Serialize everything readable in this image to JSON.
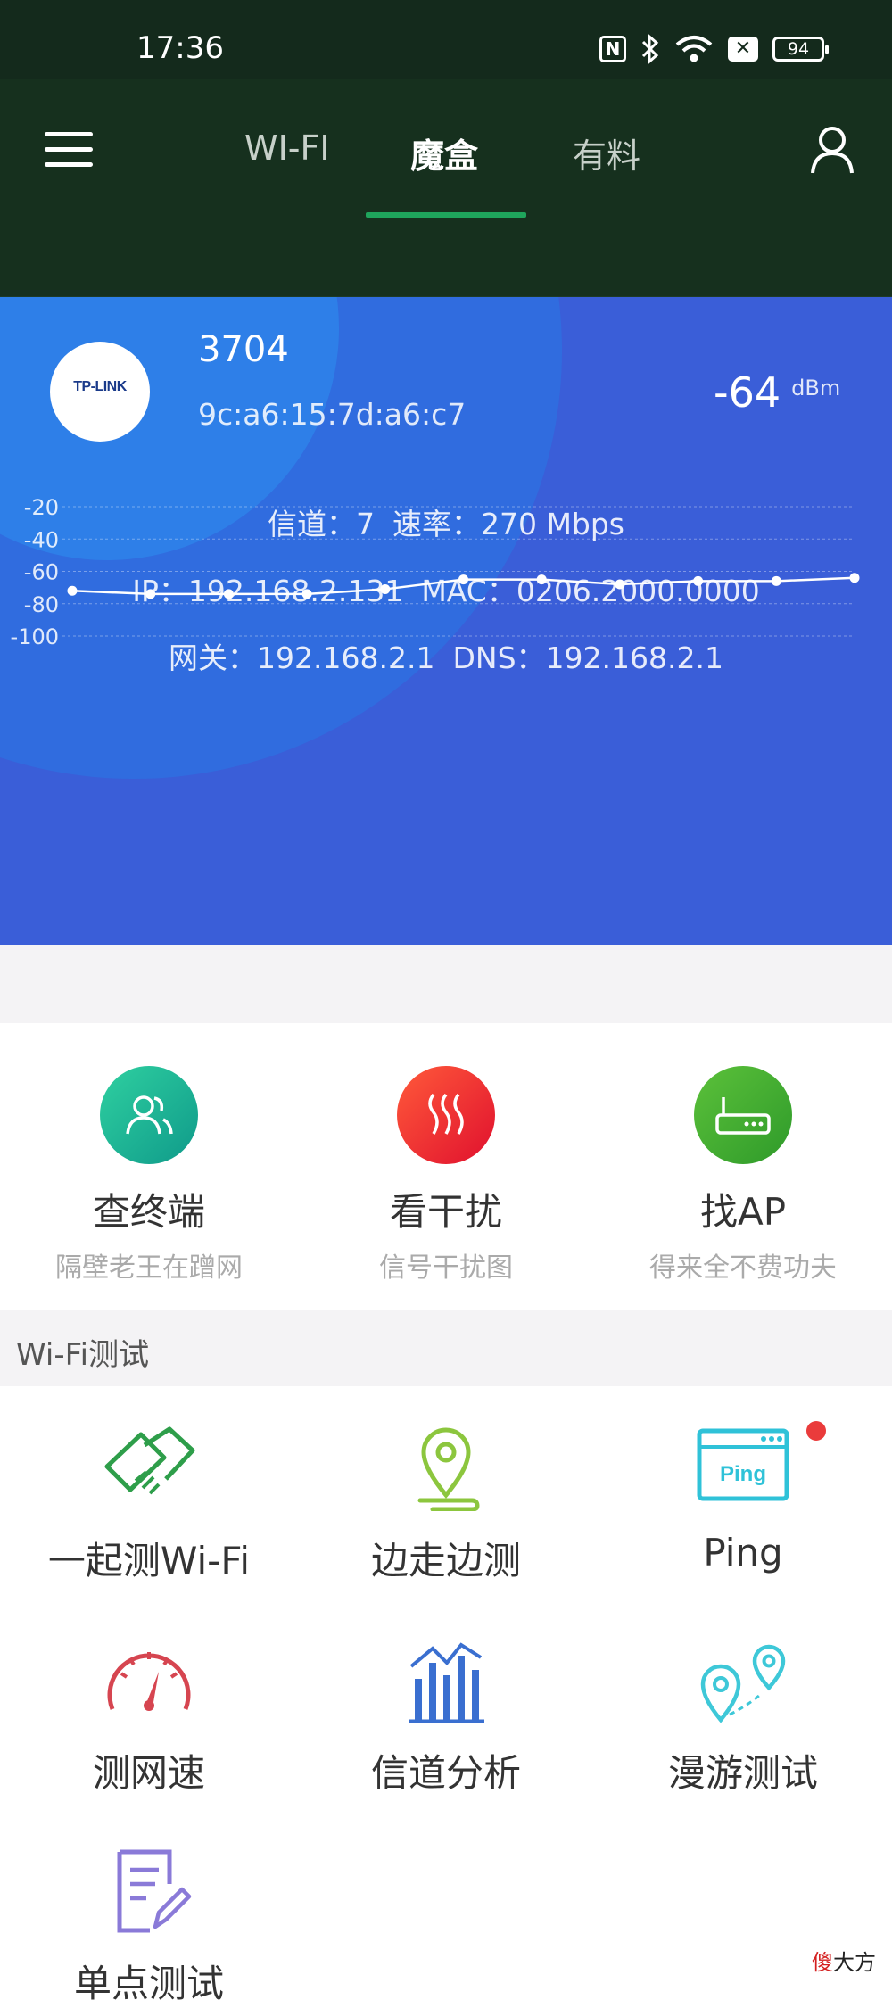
{
  "status_bar": {
    "time": "17:36",
    "battery": "94",
    "nfc_letter": "N",
    "x_letter": "✕"
  },
  "nav": {
    "tabs": [
      "WI-FI",
      "魔盒",
      "有料"
    ],
    "active_tab": "魔盒"
  },
  "connection": {
    "logo_text": "TP-LINK",
    "ssid": "3704",
    "bssid": "9c:a6:15:7d:a6:c7",
    "signal_value": "-64",
    "signal_unit": "dBm",
    "channel": "信道：7",
    "rate": "速率：270 Mbps",
    "ip": "IP：192.168.2.131",
    "mac": "MAC：0206.2000.0000",
    "gateway": "网关：192.168.2.1",
    "dns": "DNS：192.168.2.1"
  },
  "chart_data": {
    "type": "line",
    "title": "",
    "xlabel": "",
    "ylabel": "",
    "y_ticks": [
      "-20",
      "-40",
      "-60",
      "-80",
      "-100"
    ],
    "ylim": [
      -100,
      -20
    ],
    "grid": true,
    "series": [
      {
        "values": [
          -72,
          -74,
          -74,
          -74,
          -71,
          -65,
          -65,
          -68,
          -66,
          -66,
          -64
        ]
      }
    ],
    "line_color": "#ffffff"
  },
  "quick_actions": [
    {
      "title": "查终端",
      "subtitle": "隔壁老王在蹭网",
      "icon": "users-icon",
      "color_from": "#2fd0a0",
      "color_to": "#0f9a8a"
    },
    {
      "title": "看干扰",
      "subtitle": "信号干扰图",
      "icon": "interference-icon",
      "color_from": "#ff5a3a",
      "color_to": "#e0102e"
    },
    {
      "title": "找AP",
      "subtitle": "得来全不费功夫",
      "icon": "router-icon",
      "color_from": "#5cc13a",
      "color_to": "#2e9a2a"
    }
  ],
  "section": {
    "title": "Wi-Fi测试"
  },
  "tools": [
    {
      "label": "一起测Wi-Fi",
      "icon": "handshake-icon"
    },
    {
      "label": "边走边测",
      "icon": "location-pin-icon"
    },
    {
      "label": "Ping",
      "icon": "ping-icon",
      "icon_text": "Ping"
    },
    {
      "label": "测网速",
      "icon": "speedometer-icon"
    },
    {
      "label": "信道分析",
      "icon": "bar-chart-icon"
    },
    {
      "label": "漫游测试",
      "icon": "roaming-pins-icon"
    },
    {
      "label": "单点测试",
      "icon": "document-edit-icon"
    }
  ],
  "watermark": {
    "red": "傻",
    "rest": "大方"
  }
}
